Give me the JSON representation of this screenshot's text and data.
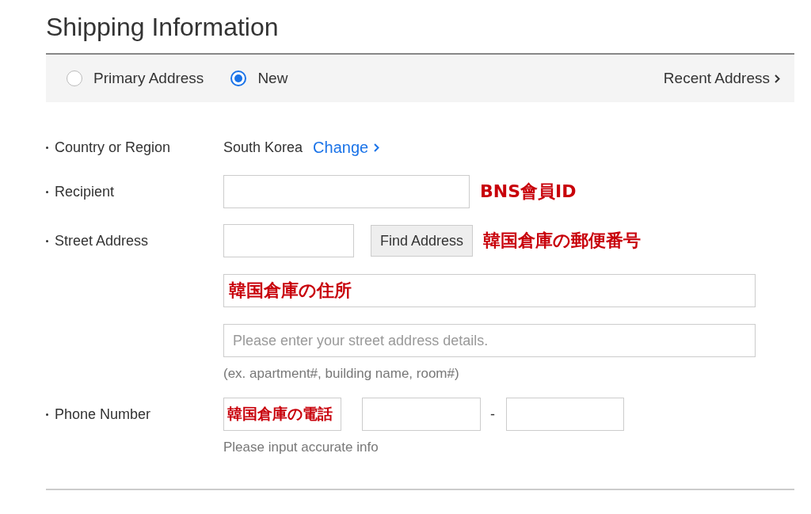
{
  "title": "Shipping Information",
  "address_options": [
    {
      "label": "Primary Address",
      "selected": false
    },
    {
      "label": "New",
      "selected": true
    }
  ],
  "recent_link": "Recent Address",
  "fields": [
    {
      "kind": "country",
      "label": "Country or Region",
      "value": "South Korea",
      "link": "Change"
    },
    {
      "kind": "text",
      "label": "Recipient",
      "annotation": "BNS會員ID"
    },
    {
      "kind": "address",
      "label": "Street Address",
      "button": "Find Address",
      "annotation": "韓国倉庫の郵便番号",
      "line1_annotation": "韓国倉庫の住所",
      "line2_placeholder": "Please enter your street address details.",
      "hint": "(ex. apartment#, building name, room#)"
    },
    {
      "kind": "phone",
      "label": "Phone Number",
      "separator": "-",
      "annotation": "韓国倉庫の電話",
      "hint": "Please input accurate info"
    }
  ]
}
